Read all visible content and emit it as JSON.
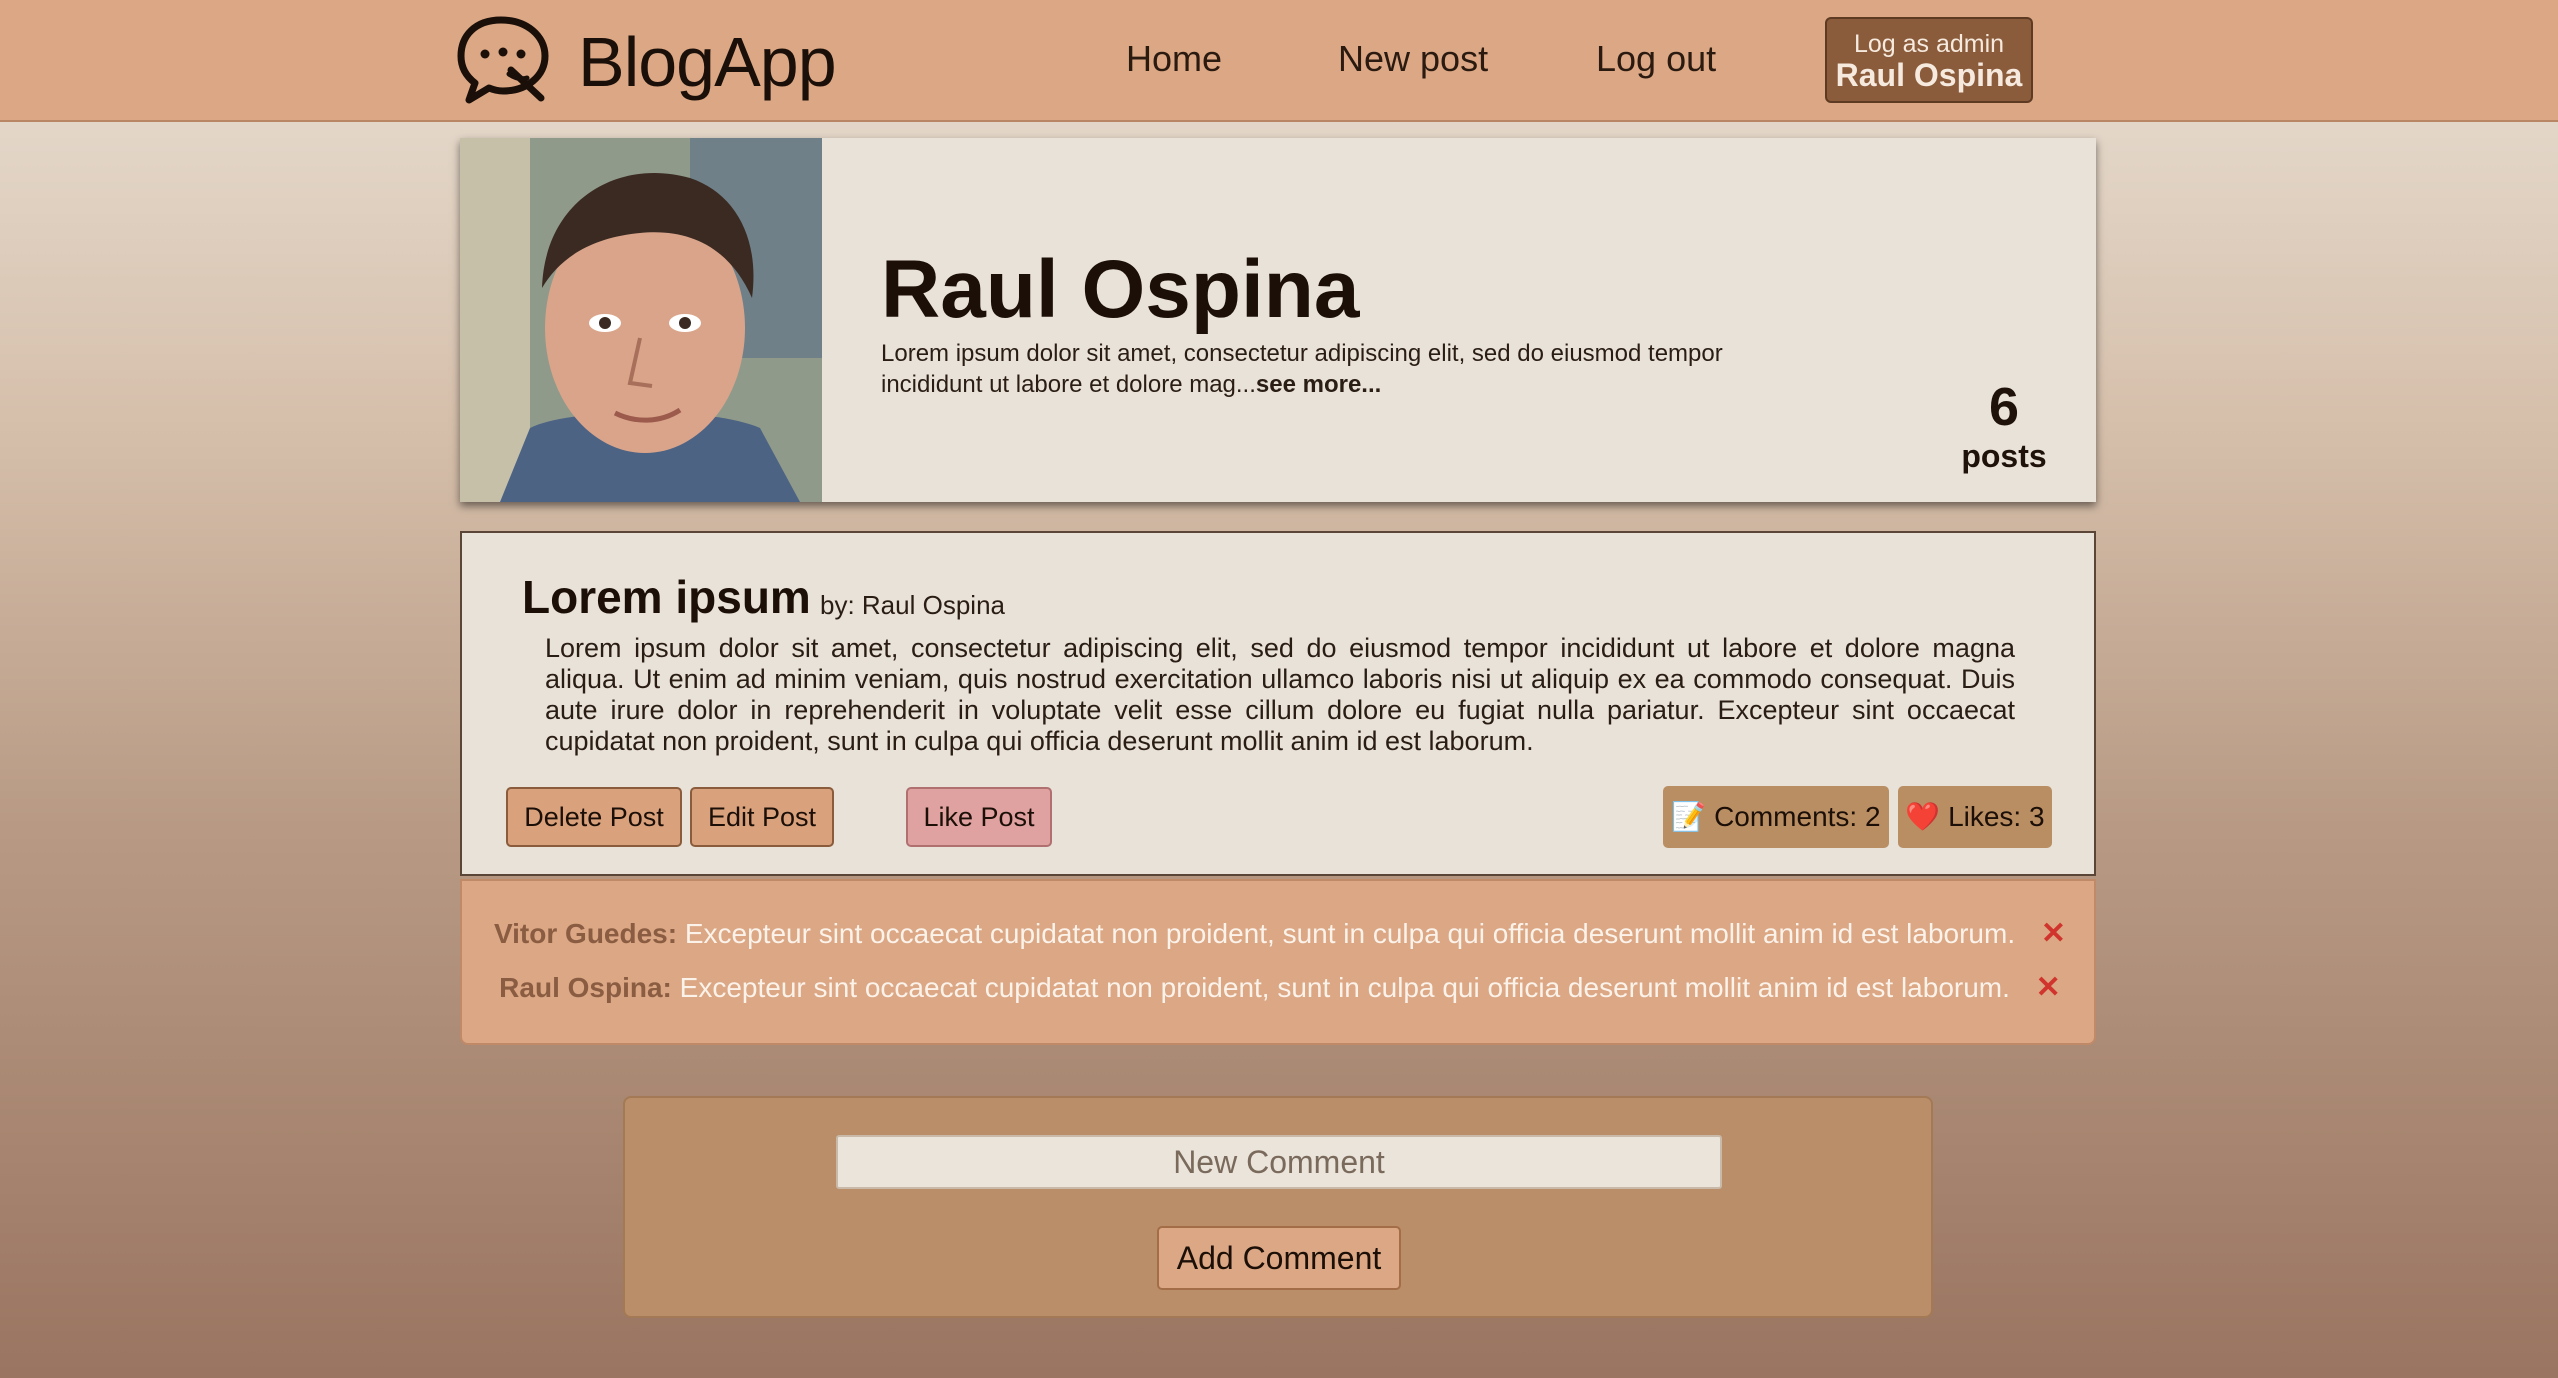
{
  "header": {
    "brand": "BlogApp",
    "logo_icon": "chat-bubble-logo-icon",
    "nav": {
      "home": "Home",
      "new_post": "New post",
      "logout": "Log out"
    },
    "admin": {
      "small": "Log as admin",
      "name": "Raul Ospina"
    }
  },
  "profile": {
    "name": "Raul Ospina",
    "bio": "Lorem ipsum dolor sit amet, consectetur adipiscing elit, sed do eiusmod tempor incididunt ut labore et dolore mag...",
    "see_more": "see more...",
    "post_count": "6",
    "post_label": "posts"
  },
  "post": {
    "title": "Lorem ipsum",
    "by": "by: Raul Ospina",
    "body": "Lorem ipsum dolor sit amet, consectetur adipiscing elit, sed do eiusmod tempor incididunt ut labore et dolore magna aliqua. Ut enim ad minim veniam, quis nostrud exercitation ullamco laboris nisi ut aliquip ex ea commodo consequat. Duis aute irure dolor in reprehenderit in voluptate velit esse cillum dolore eu fugiat nulla pariatur. Excepteur sint occaecat cupidatat non proident, sunt in culpa qui officia deserunt mollit anim id est laborum.",
    "delete_label": "Delete Post",
    "edit_label": "Edit Post",
    "like_label": "Like Post",
    "comments_badge": "📝 Comments: 2",
    "likes_badge": "❤️ Likes: 3"
  },
  "comments": [
    {
      "author": "Vitor Guedes:",
      "text": "Excepteur sint occaecat cupidatat non proident, sunt in culpa qui officia deserunt mollit anim id est laborum.",
      "delete_icon": "✕"
    },
    {
      "author": "Raul Ospina:",
      "text": "Excepteur sint occaecat cupidatat non proident, sunt in culpa qui officia deserunt mollit anim id est laborum.",
      "delete_icon": "✕"
    }
  ],
  "form": {
    "placeholder": "New Comment",
    "add_label": "Add Comment"
  },
  "colors": {
    "header_bg": "#dba784",
    "card_bg": "#e9e2d8",
    "button_bg": "#d9a27d",
    "like_bg": "#e0a2a0",
    "admin_bg": "#8a5c3c",
    "delete_x": "#d0342c"
  }
}
